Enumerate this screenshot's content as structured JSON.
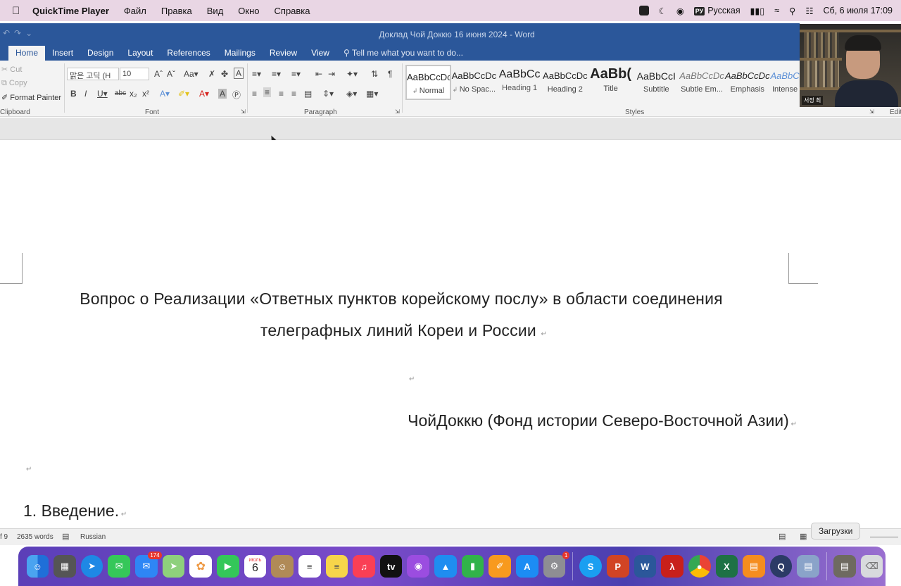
{
  "menubar": {
    "app": "QuickTime Player",
    "items": [
      "Файл",
      "Правка",
      "Вид",
      "Окно",
      "Справка"
    ],
    "input_badge": "РУ",
    "input_source": "Русская",
    "datetime": "Сб, 6 июля  17:09"
  },
  "word": {
    "title": "Доклад Чой Доккю 16 июня 2024 - Word",
    "tabs": [
      "Home",
      "Insert",
      "Design",
      "Layout",
      "References",
      "Mailings",
      "Review",
      "View"
    ],
    "tell_me": "Tell me what you want to do...",
    "clipboard": {
      "cut": "Cut",
      "copy": "Copy",
      "format_painter": "Format Painter",
      "label": "Clipboard"
    },
    "font": {
      "name": "맑은 고딕 (H",
      "size": "10",
      "label": "Font"
    },
    "paragraph_label": "Paragraph",
    "styles_label": "Styles",
    "editing_label": "Edit",
    "styles": [
      {
        "preview": "AaBbCcDc",
        "name": "Normal"
      },
      {
        "preview": "AaBbCcDc",
        "name": "No Spac..."
      },
      {
        "preview": "AaBbCc",
        "name": "Heading 1"
      },
      {
        "preview": "AaBbCcDc",
        "name": "Heading 2"
      },
      {
        "preview": "AaBb(",
        "name": "Title"
      },
      {
        "preview": "AaBbCcI",
        "name": "Subtitle"
      },
      {
        "preview": "AaBbCcDc",
        "name": "Subtle Em..."
      },
      {
        "preview": "AaBbCcDc",
        "name": "Emphasis"
      },
      {
        "preview": "AaBbC",
        "name": "Intense"
      }
    ]
  },
  "document": {
    "title_line1": "Вопрос о Реализации «Ответных пунктов корейскому послу» в области соединения",
    "title_line2": "телеграфных линий Кореи и России",
    "author": "ЧойДоккю  (Фонд истории Северо-Восточной Азии)",
    "heading": "1. Введение."
  },
  "statusbar": {
    "page": "f 9",
    "words": "2635 words",
    "language": "Russian"
  },
  "tooltip": "Загрузки",
  "video": {
    "caption": "서정 최"
  },
  "dock": {
    "mail_badge": "174",
    "calendar_month": "ИЮЛЬ",
    "calendar_day": "6",
    "settings_badge": "1"
  }
}
